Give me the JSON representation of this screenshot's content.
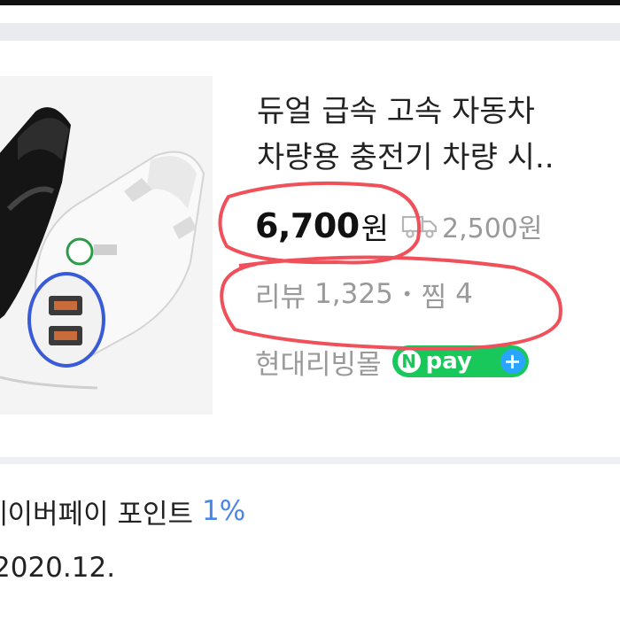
{
  "product": {
    "title_line1": "듀얼 급속 고속 자동차",
    "title_line2": "차량용 충전기 차량 시..",
    "price": "6,700",
    "currency": "원",
    "shipping": "2,500원",
    "review_label": "리뷰",
    "review_count": "1,325",
    "separator": "•",
    "zzim_label": "찜",
    "zzim_count": "4",
    "store_name": "현대리빙몰",
    "npay_n": "N",
    "npay_text": "pay",
    "npay_plus": "+"
  },
  "details": {
    "point_label": "네이버페이 포인트",
    "point_value": "1%",
    "date": "2020.12."
  },
  "colors": {
    "accent_blue": "#4a86e8",
    "npay_green": "#19c85a",
    "annotation_red": "#f0505a"
  },
  "icons": [
    "truck-icon",
    "npay-logo",
    "plus-icon"
  ]
}
